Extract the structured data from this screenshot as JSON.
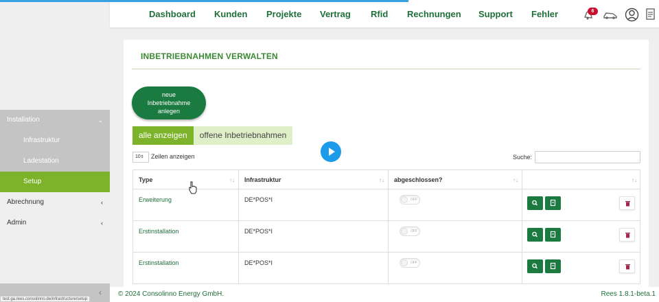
{
  "nav": {
    "items": [
      "Dashboard",
      "Kunden",
      "Projekte",
      "Vertrag",
      "Rfid",
      "Rechnungen",
      "Support",
      "Fehler"
    ],
    "notification_count": "6",
    "icons": [
      "bell-icon",
      "car-icon",
      "user-circle-icon",
      "document-icon"
    ]
  },
  "sidebar": {
    "installation": "Installation",
    "infrastruktur": "Infrastruktur",
    "ladestation": "Ladestation",
    "setup": "Setup",
    "abrechnung": "Abrechnung",
    "admin": "Admin",
    "url_hint": "test.ga.rees.consolinno.de/infrastructure/setup"
  },
  "page": {
    "title": "INBETRIEBNAHMEN VERWALTEN",
    "new_button": [
      "neue",
      "Inbetriebnahme",
      "anlegen"
    ],
    "filter_all": "alle anzeigen",
    "filter_open": "offene Inbetriebnahmen",
    "page_length": "10",
    "length_label": "Zeilen anzeigen",
    "search_label": "Suche:",
    "search_value": ""
  },
  "table": {
    "headers": [
      "Type",
      "Infrastruktur",
      "abgeschlossen?",
      ""
    ],
    "toggle_label": "OFF",
    "rows": [
      {
        "type": "Erweiterung",
        "infrastruktur": "DE*POS*I"
      },
      {
        "type": "Erstinstallation",
        "infrastruktur": "DE*POS*I"
      },
      {
        "type": "Erstinstallation",
        "infrastruktur": "DE*POS*I"
      }
    ]
  },
  "footer": {
    "copyright": "© 2024 Consolinno Energy GmbH.",
    "version": "Rees 1.8.1-beta.1"
  },
  "colors": {
    "primary_green": "#1a7a40",
    "accent_green": "#7cb32b",
    "badge_red": "#c8102e",
    "play_blue": "#1c9bea"
  }
}
